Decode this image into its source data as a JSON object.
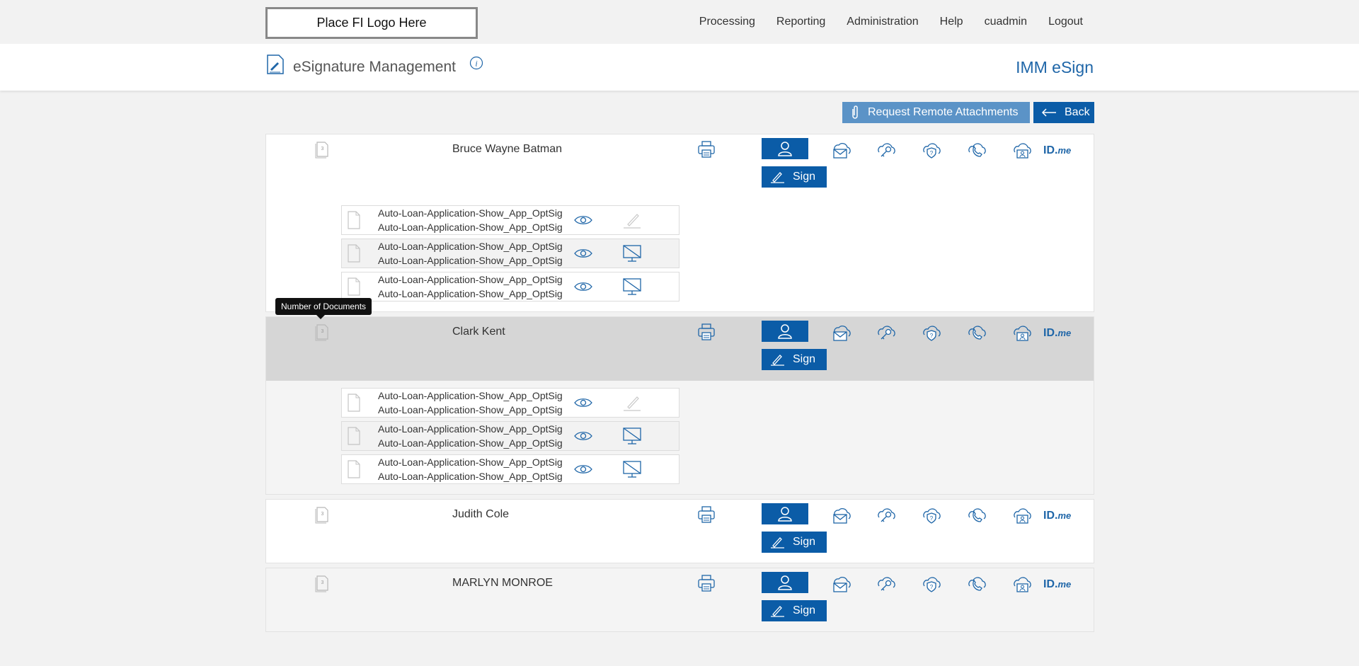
{
  "header": {
    "logo_text": "Place FI Logo Here",
    "nav": [
      "Processing",
      "Reporting",
      "Administration",
      "Help",
      "cuadmin",
      "Logout"
    ]
  },
  "titlebar": {
    "title": "eSignature Management",
    "product": "IMM eSign"
  },
  "actions": {
    "request_attachments": "Request Remote Attachments",
    "back": "Back"
  },
  "signers": [
    {
      "name": "Bruce Wayne Batman",
      "doc_count": "3",
      "sign_label": "Sign",
      "docs": [
        {
          "line1": "Auto-Loan-Application-Show_App_OptSig",
          "line2": "Auto-Loan-Application-Show_App_OptSig",
          "action": "sign"
        },
        {
          "line1": "Auto-Loan-Application-Show_App_OptSig",
          "line2": "Auto-Loan-Application-Show_App_OptSig",
          "action": "no-display"
        },
        {
          "line1": "Auto-Loan-Application-Show_App_OptSig",
          "line2": "Auto-Loan-Application-Show_App_OptSig",
          "action": "no-display"
        }
      ]
    },
    {
      "name": "Clark Kent",
      "doc_count": "3",
      "sign_label": "Sign",
      "docs": [
        {
          "line1": "Auto-Loan-Application-Show_App_OptSig",
          "line2": "Auto-Loan-Application-Show_App_OptSig",
          "action": "sign"
        },
        {
          "line1": "Auto-Loan-Application-Show_App_OptSig",
          "line2": "Auto-Loan-Application-Show_App_OptSig",
          "action": "no-display"
        },
        {
          "line1": "Auto-Loan-Application-Show_App_OptSig",
          "line2": "Auto-Loan-Application-Show_App_OptSig",
          "action": "no-display"
        }
      ]
    },
    {
      "name": "Judith Cole",
      "doc_count": "3",
      "sign_label": "Sign",
      "docs": []
    },
    {
      "name": "MARLYN MONROE",
      "doc_count": "3",
      "sign_label": "Sign",
      "docs": []
    }
  ],
  "tooltip": "Number of Documents",
  "idme": {
    "main": "ID.",
    "suffix": "me"
  },
  "colors": {
    "primary": "#0b5ca7",
    "secondary": "#5b93c7",
    "accent_text": "#1f66a8"
  },
  "auth_icons": [
    "person-icon",
    "cloud-mail-icon",
    "cloud-key-icon",
    "cloud-question-icon",
    "cloud-phone-icon",
    "cloud-id-card-icon",
    "idme-icon"
  ]
}
